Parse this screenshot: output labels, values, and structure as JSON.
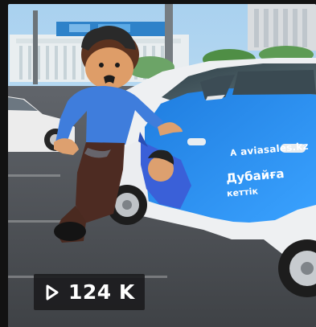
{
  "video": {
    "views": "124 K",
    "play_icon": "play-icon"
  },
  "car_wrap": {
    "brand": "aviasales.kz",
    "line1": "Дубайға",
    "line2": "кеттік"
  },
  "colors": {
    "car_blue": "#2a8ef0",
    "badge_bg": "#1c1c1e",
    "sky": "#b8d7ee"
  }
}
